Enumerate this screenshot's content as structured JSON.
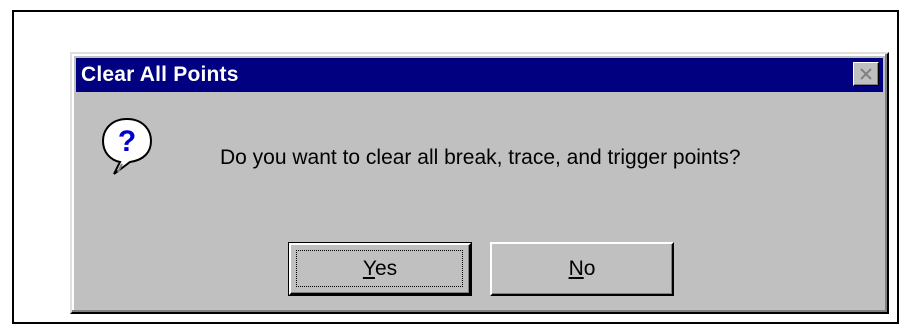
{
  "dialog": {
    "title": "Clear All Points",
    "message": "Do you want to clear all break, trace, and trigger points?",
    "icon": "question-icon",
    "close_icon": "close-icon"
  },
  "buttons": {
    "yes": {
      "mnemonic": "Y",
      "rest": "es"
    },
    "no": {
      "mnemonic": "N",
      "rest": "o"
    }
  },
  "colors": {
    "title_bar": "#000080",
    "dialog_face": "#c0c0c0",
    "icon_blue": "#0000cc"
  }
}
